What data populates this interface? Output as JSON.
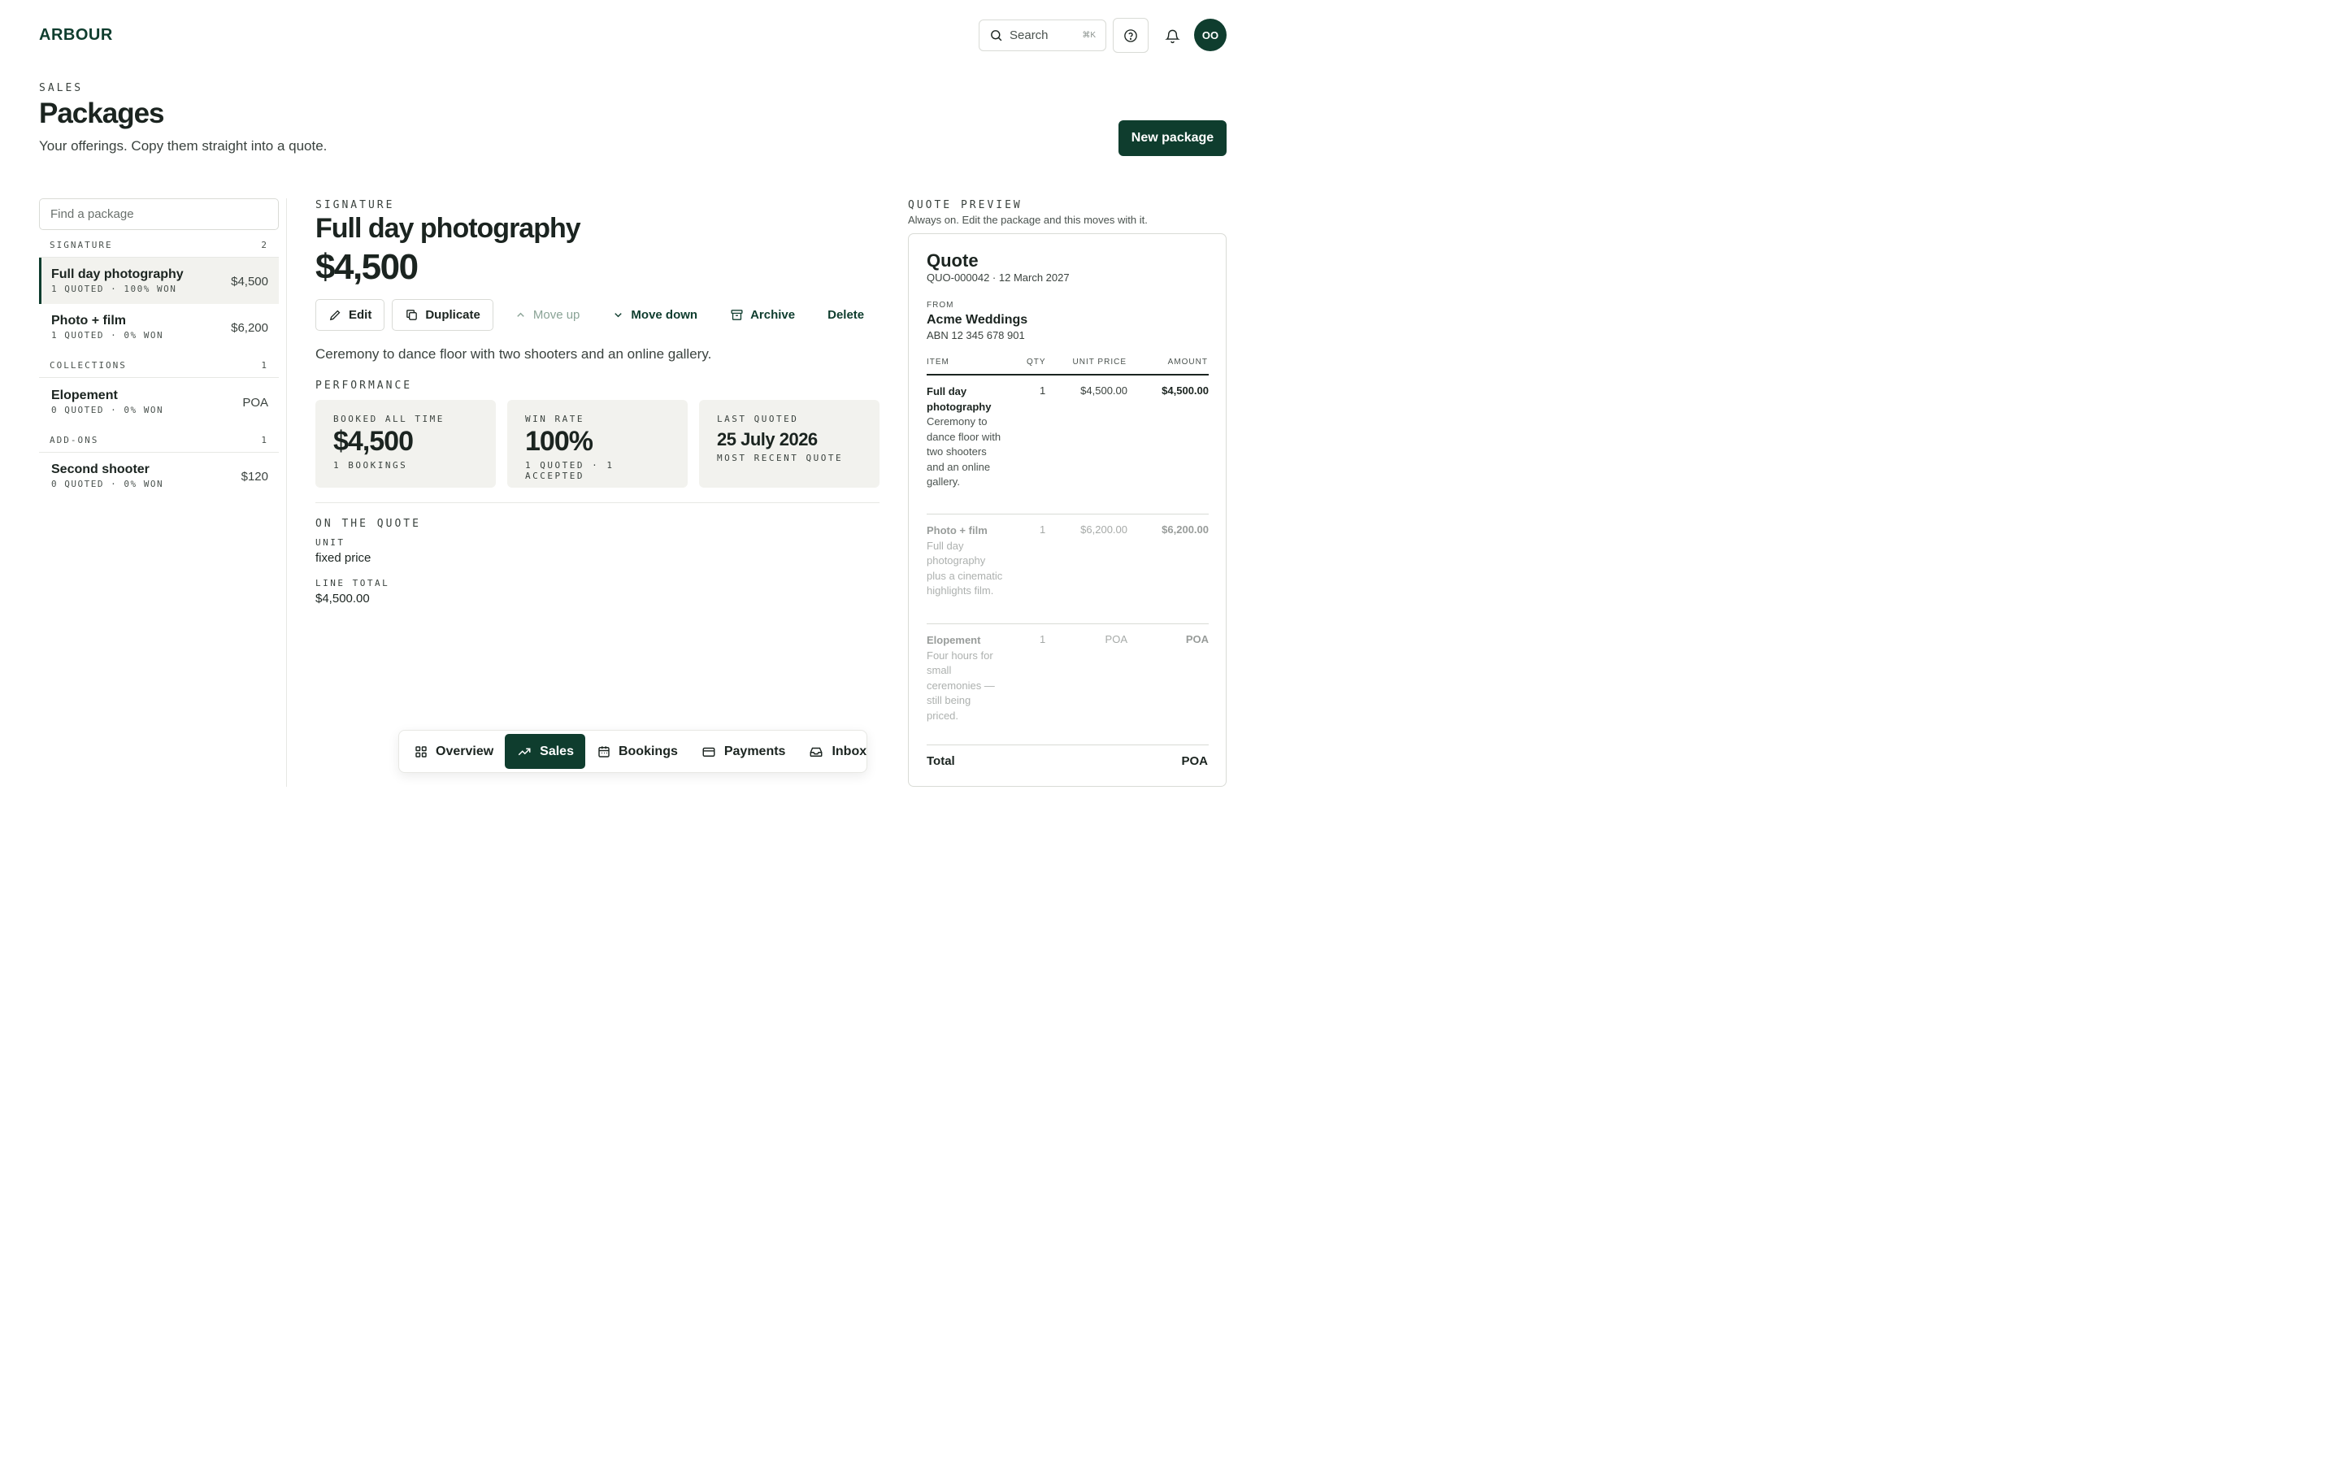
{
  "app": {
    "logo": "ARBOUR"
  },
  "header": {
    "search_placeholder": "Search",
    "search_shortcut": "⌘K",
    "avatar_initials": "OO"
  },
  "page": {
    "kicker": "SALES",
    "title": "Packages",
    "subtitle": "Your offerings. Copy them straight into a quote.",
    "new_button": "New package"
  },
  "sidebar": {
    "find_placeholder": "Find a package",
    "groups": [
      {
        "name": "SIGNATURE",
        "count": "2"
      },
      {
        "name": "COLLECTIONS",
        "count": "1"
      },
      {
        "name": "ADD-ONS",
        "count": "1"
      }
    ],
    "packages": [
      {
        "name": "Full day photography",
        "meta": "1 QUOTED · 100% WON",
        "price": "$4,500"
      },
      {
        "name": "Photo + film",
        "meta": "1 QUOTED · 0% WON",
        "price": "$6,200"
      },
      {
        "name": "Elopement",
        "meta": "0 QUOTED · 0% WON",
        "price": "POA"
      },
      {
        "name": "Second shooter",
        "meta": "0 QUOTED · 0% WON",
        "price": "$120"
      }
    ]
  },
  "detail": {
    "group": "SIGNATURE",
    "title": "Full day photography",
    "price": "$4,500",
    "actions": {
      "edit": "Edit",
      "duplicate": "Duplicate",
      "move_up": "Move up",
      "move_down": "Move down",
      "archive": "Archive",
      "delete": "Delete"
    },
    "description": "Ceremony to dance floor with two shooters and an online gallery.",
    "performance_label": "PERFORMANCE",
    "stats": [
      {
        "label": "BOOKED ALL TIME",
        "value": "$4,500",
        "sub": "1 BOOKINGS"
      },
      {
        "label": "WIN RATE",
        "value": "100%",
        "sub": "1 QUOTED · 1 ACCEPTED"
      },
      {
        "label": "LAST QUOTED",
        "value": "25 July 2026",
        "sub": "MOST RECENT QUOTE"
      }
    ],
    "on_quote_label": "ON THE QUOTE",
    "unit_label": "UNIT",
    "unit_value": "fixed price",
    "line_total_label": "LINE TOTAL",
    "line_total_value": "$4,500.00"
  },
  "quote_preview": {
    "kicker": "QUOTE PREVIEW",
    "subtitle": "Always on. Edit the package and this moves with it.",
    "title": "Quote",
    "number": "QUO-000042 · 12 March 2027",
    "from_label": "FROM",
    "from_name": "Acme Weddings",
    "abn": "ABN 12 345 678 901",
    "columns": {
      "item": "ITEM",
      "qty": "QTY",
      "unit_price": "UNIT PRICE",
      "amount": "AMOUNT"
    },
    "rows": [
      {
        "name": "Full day photography",
        "desc": "Ceremony to dance floor with two shooters and an online gallery.",
        "qty": "1",
        "unit_price": "$4,500.00",
        "amount": "$4,500.00"
      },
      {
        "name": "Photo + film",
        "desc": "Full day photography plus a cinematic highlights film.",
        "qty": "1",
        "unit_price": "$6,200.00",
        "amount": "$6,200.00"
      },
      {
        "name": "Elopement",
        "desc": "Four hours for small ceremonies — still being priced.",
        "qty": "1",
        "unit_price": "POA",
        "amount": "POA"
      }
    ],
    "total_label": "Total",
    "total_value": "POA"
  },
  "bottom_nav": {
    "items": [
      {
        "label": "Overview",
        "icon": "grid-icon"
      },
      {
        "label": "Sales",
        "icon": "trending-up-icon"
      },
      {
        "label": "Bookings",
        "icon": "calendar-icon"
      },
      {
        "label": "Payments",
        "icon": "credit-card-icon"
      },
      {
        "label": "Inbox",
        "icon": "inbox-icon"
      }
    ],
    "active": "Sales"
  },
  "colors": {
    "brand": "#0f3d2e",
    "panel": "#f2f2ee",
    "border": "#d9dbd6"
  }
}
